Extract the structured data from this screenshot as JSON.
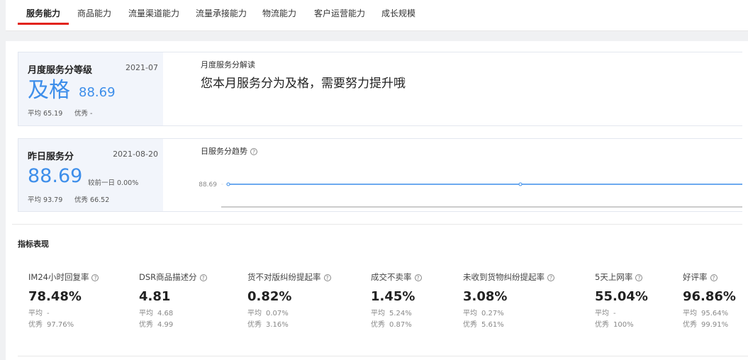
{
  "tabs": [
    "服务能力",
    "商品能力",
    "流量渠道能力",
    "流量承接能力",
    "物流能力",
    "客户运营能力",
    "成长规模"
  ],
  "monthly": {
    "title": "月度服务分等级",
    "date": "2021-07",
    "grade": "及格",
    "score": "88.69",
    "avg_label": "平均",
    "avg_value": "65.19",
    "excellent_label": "优秀",
    "excellent_value": "-",
    "interpretation_title": "月度服务分解读",
    "interpretation_text": "您本月服务分为及格，需要努力提升哦"
  },
  "daily": {
    "title": "昨日服务分",
    "date": "2021-08-20",
    "score": "88.69",
    "compare_label": "较前一日",
    "compare_value": "0.00%",
    "avg_label": "平均",
    "avg_value": "93.79",
    "excellent_label": "优秀",
    "excellent_value": "66.52",
    "trend_title": "日服务分趋势",
    "help_icon": "?"
  },
  "chart_data": {
    "type": "line",
    "title": "日服务分趋势",
    "y_tick_labels": [
      "88.69"
    ],
    "series": [
      {
        "values": [
          88.69,
          88.69,
          88.69
        ]
      }
    ],
    "ylim": [
      88.69,
      88.69
    ],
    "color": "#3d8eea"
  },
  "indicators": {
    "title": "指标表现",
    "avg_label": "平均",
    "excellent_label": "优秀",
    "items": [
      {
        "label": "IM24小时回复率",
        "value": "78.48%",
        "avg": "-",
        "excellent": "97.76%"
      },
      {
        "label": "DSR商品描述分",
        "value": "4.81",
        "avg": "4.68",
        "excellent": "4.99"
      },
      {
        "label": "货不对版纠纷提起率",
        "value": "0.82%",
        "avg": "0.07%",
        "excellent": "3.16%"
      },
      {
        "label": "成交不卖率",
        "value": "1.45%",
        "avg": "5.24%",
        "excellent": "0.87%"
      },
      {
        "label": "未收到货物纠纷提起率",
        "value": "3.08%",
        "avg": "0.27%",
        "excellent": "5.61%"
      },
      {
        "label": "5天上网率",
        "value": "55.04%",
        "avg": "-",
        "excellent": "100%"
      },
      {
        "label": "好评率",
        "value": "96.86%",
        "avg": "95.64%",
        "excellent": "99.91%"
      }
    ]
  },
  "colors": {
    "accent": "#e2231a",
    "primary": "#3d8eea"
  }
}
